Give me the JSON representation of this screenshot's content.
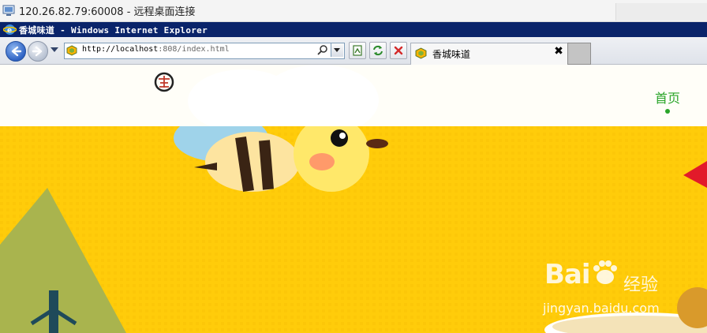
{
  "remote_desktop": {
    "title": "120.26.82.79:60008 - 远程桌面连接",
    "icon": "remote-desktop-icon"
  },
  "ie": {
    "window_title": "香城味道 - Windows Internet Explorer",
    "address_url_host": "http://localhost",
    "address_url_path": ":808/index.html",
    "tab_label": "香城味道",
    "tab_close": "✖"
  },
  "site": {
    "nav_home": "首页",
    "accent_color": "#2aa52a",
    "banner_color": "#ffcc0a"
  },
  "watermark": {
    "brand": "Bai",
    "brand_suffix": "经验",
    "url": "jingyan.baidu.com"
  }
}
